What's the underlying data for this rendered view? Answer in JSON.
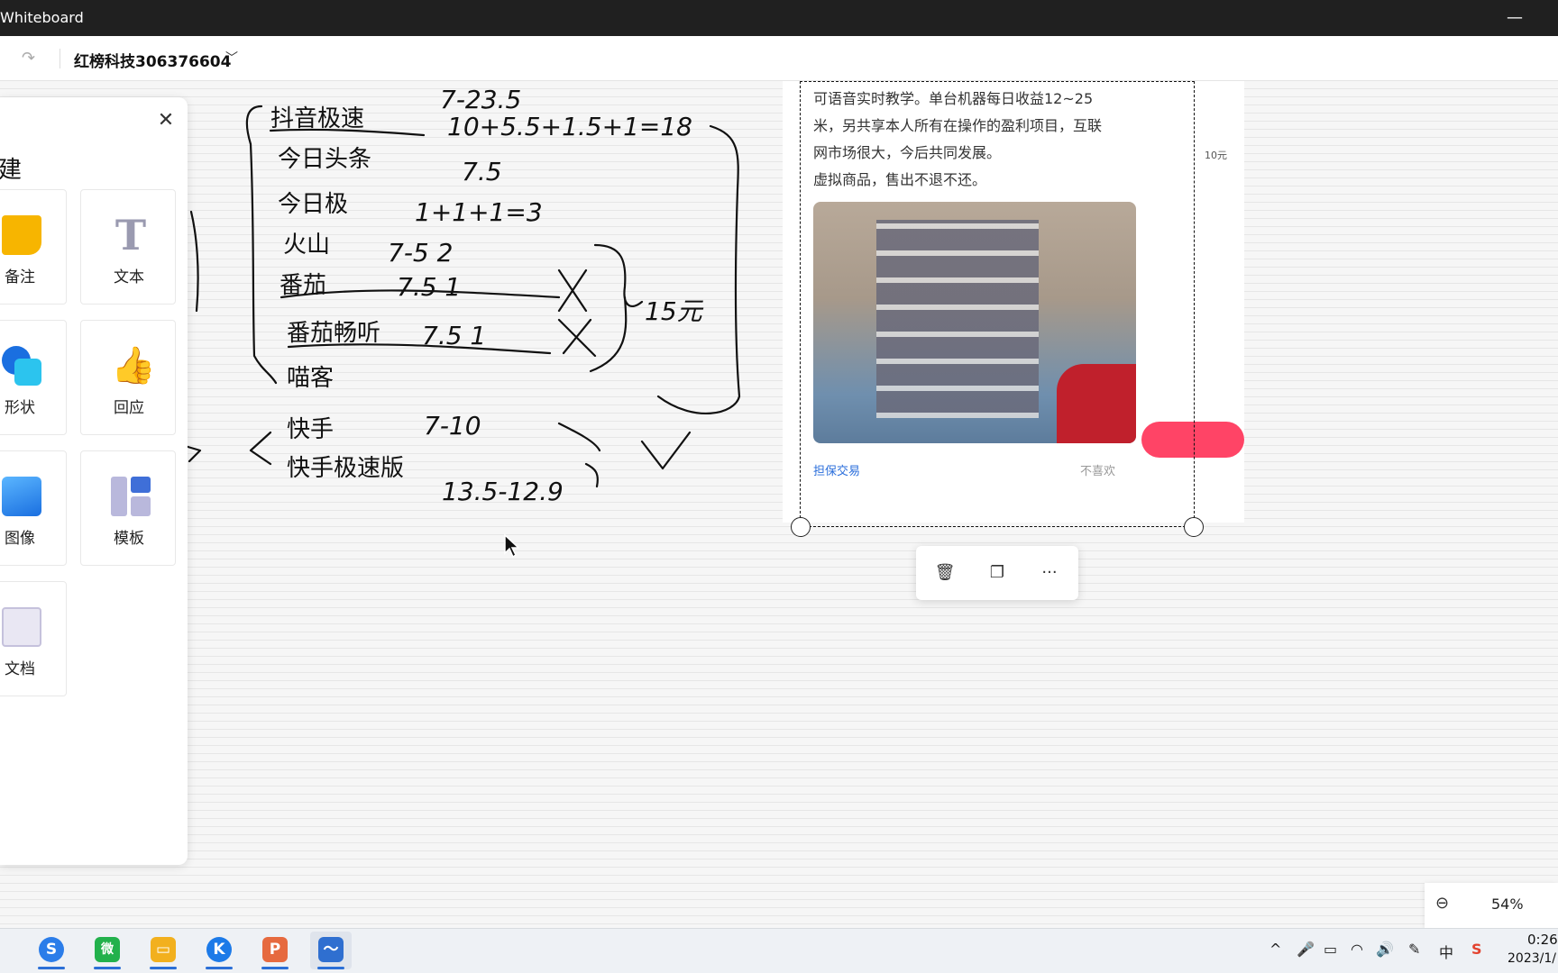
{
  "window": {
    "title": "Whiteboard",
    "minimize_glyph": "—"
  },
  "toolbar": {
    "redo_icon": "redo-icon",
    "board_name": "红榜科技306376604",
    "dropdown_icon": "chevron-down-icon"
  },
  "create_panel": {
    "title": "建",
    "close_icon": "close-icon",
    "tiles": [
      {
        "label": "备注",
        "icon": "sticky-note-icon",
        "color": "#f7b500"
      },
      {
        "label": "文本",
        "icon": "text-icon",
        "color": "#9a9ab0"
      },
      {
        "label": "形状",
        "icon": "shapes-icon",
        "color": "#1a86e8"
      },
      {
        "label": "回应",
        "icon": "thumbs-up-icon",
        "color": "#f5a623"
      },
      {
        "label": "图像",
        "icon": "image-icon",
        "color": "#2f8fe8"
      },
      {
        "label": "模板",
        "icon": "template-icon",
        "color": "#4a78d8"
      },
      {
        "label": "文档",
        "icon": "document-icon",
        "color": "#b9b4d6"
      }
    ]
  },
  "card": {
    "lines": [
      "可语音实时教学。单台机器每日收益12~25",
      "米，另共享本人所有在操作的盈利项目，互联",
      "网市场很大，今后共同发展。",
      "虚拟商品，售出不退不还。"
    ],
    "guarantee": "担保交易",
    "dislike": "不喜欢",
    "price": "10元"
  },
  "ink": {
    "lines": [
      {
        "text": "抖音极速",
        "underline": true
      },
      {
        "text": "今日头条"
      },
      {
        "text": "今日极"
      },
      {
        "text": "火山"
      },
      {
        "text": "番茄"
      },
      {
        "text": "番茄畅听"
      },
      {
        "text": "喵客"
      },
      {
        "text": "快手"
      },
      {
        "text": "快手极速版"
      }
    ],
    "formulas": [
      "7-23.5",
      "10+5.5+1.5+1=18",
      "7.5",
      "1+1+1=3",
      "7-5 2",
      "7.5 1",
      "7.5 1",
      "7-10",
      "13.5-12.9",
      "15元"
    ]
  },
  "context_bar": {
    "delete_icon": "trash-icon",
    "copy_icon": "copy-icon",
    "more_label": "···"
  },
  "zoom": {
    "icon": "zoom-out-icon",
    "value": "54%"
  },
  "taskbar": {
    "apps": [
      {
        "name": "sogou-browser",
        "glyph": "S",
        "color": "#2b7de9"
      },
      {
        "name": "wechat",
        "glyph": "微",
        "color": "#22b14c"
      },
      {
        "name": "file-explorer",
        "glyph": "▭",
        "color": "#f2b01e"
      },
      {
        "name": "kugou",
        "glyph": "K",
        "color": "#1c7ae8"
      },
      {
        "name": "powerpoint",
        "glyph": "P",
        "color": "#e66a3f"
      },
      {
        "name": "whiteboard",
        "glyph": "〜",
        "color": "#2f6fd0"
      }
    ],
    "tray": [
      "^",
      "🎤",
      "▭",
      "◠",
      "🔊",
      "✎",
      "中",
      "S"
    ],
    "time": "0:26",
    "date": "2023/1/"
  }
}
